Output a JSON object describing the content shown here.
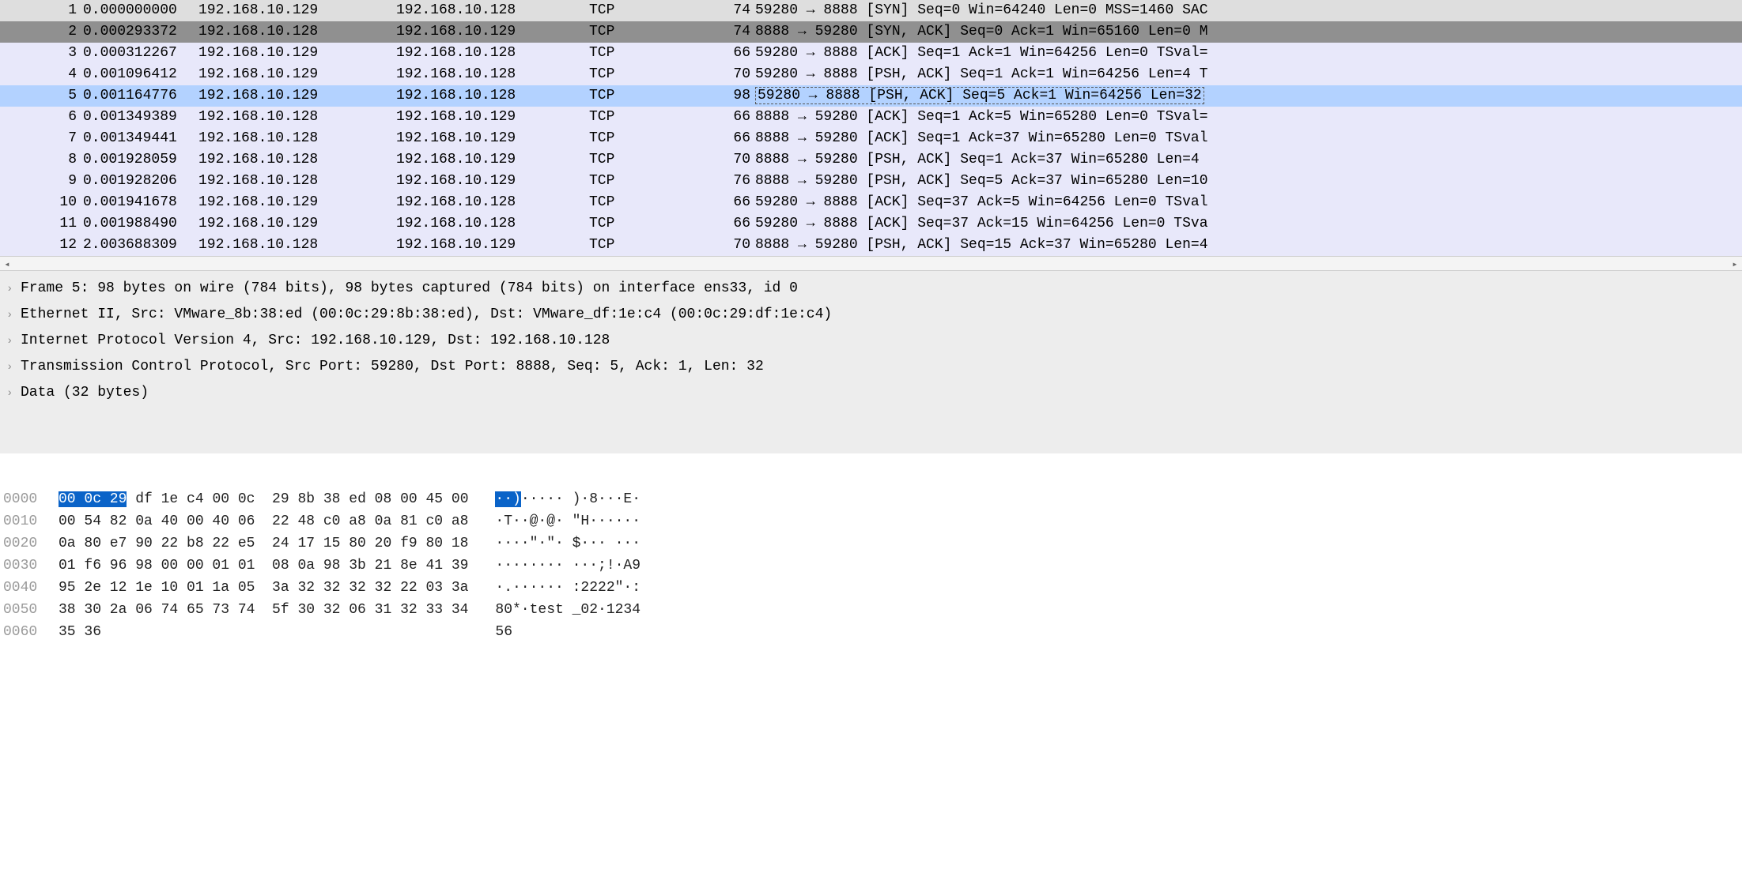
{
  "packets": [
    {
      "no": "1",
      "time": "0.000000000",
      "src": "192.168.10.129",
      "dst": "192.168.10.128",
      "prot": "TCP",
      "len": "74",
      "info": "59280 → 8888 [SYN] Seq=0 Win=64240 Len=0 MSS=1460 SAC",
      "cls": "row-syn"
    },
    {
      "no": "2",
      "time": "0.000293372",
      "src": "192.168.10.128",
      "dst": "192.168.10.129",
      "prot": "TCP",
      "len": "74",
      "info": "8888 → 59280 [SYN, ACK] Seq=0 Ack=1 Win=65160 Len=0 M",
      "cls": "row-synack"
    },
    {
      "no": "3",
      "time": "0.000312267",
      "src": "192.168.10.129",
      "dst": "192.168.10.128",
      "prot": "TCP",
      "len": "66",
      "info": "59280 → 8888 [ACK] Seq=1 Ack=1 Win=64256 Len=0 TSval=",
      "cls": "row-tcp"
    },
    {
      "no": "4",
      "time": "0.001096412",
      "src": "192.168.10.129",
      "dst": "192.168.10.128",
      "prot": "TCP",
      "len": "70",
      "info": "59280 → 8888 [PSH, ACK] Seq=1 Ack=1 Win=64256 Len=4 T",
      "cls": "row-tcp"
    },
    {
      "no": "5",
      "time": "0.001164776",
      "src": "192.168.10.129",
      "dst": "192.168.10.128",
      "prot": "TCP",
      "len": "98",
      "info": "59280 → 8888 [PSH, ACK] Seq=5 Ack=1 Win=64256 Len=32 ",
      "cls": "row-selected"
    },
    {
      "no": "6",
      "time": "0.001349389",
      "src": "192.168.10.128",
      "dst": "192.168.10.129",
      "prot": "TCP",
      "len": "66",
      "info": "8888 → 59280 [ACK] Seq=1 Ack=5 Win=65280 Len=0 TSval=",
      "cls": "row-tcp"
    },
    {
      "no": "7",
      "time": "0.001349441",
      "src": "192.168.10.128",
      "dst": "192.168.10.129",
      "prot": "TCP",
      "len": "66",
      "info": "8888 → 59280 [ACK] Seq=1 Ack=37 Win=65280 Len=0 TSval",
      "cls": "row-tcp"
    },
    {
      "no": "8",
      "time": "0.001928059",
      "src": "192.168.10.128",
      "dst": "192.168.10.129",
      "prot": "TCP",
      "len": "70",
      "info": "8888 → 59280 [PSH, ACK] Seq=1 Ack=37 Win=65280 Len=4 ",
      "cls": "row-tcp"
    },
    {
      "no": "9",
      "time": "0.001928206",
      "src": "192.168.10.128",
      "dst": "192.168.10.129",
      "prot": "TCP",
      "len": "76",
      "info": "8888 → 59280 [PSH, ACK] Seq=5 Ack=37 Win=65280 Len=10",
      "cls": "row-tcp"
    },
    {
      "no": "10",
      "time": "0.001941678",
      "src": "192.168.10.129",
      "dst": "192.168.10.128",
      "prot": "TCP",
      "len": "66",
      "info": "59280 → 8888 [ACK] Seq=37 Ack=5 Win=64256 Len=0 TSval",
      "cls": "row-tcp"
    },
    {
      "no": "11",
      "time": "0.001988490",
      "src": "192.168.10.129",
      "dst": "192.168.10.128",
      "prot": "TCP",
      "len": "66",
      "info": "59280 → 8888 [ACK] Seq=37 Ack=15 Win=64256 Len=0 TSva",
      "cls": "row-tcp"
    },
    {
      "no": "12",
      "time": "2.003688309",
      "src": "192.168.10.128",
      "dst": "192.168.10.129",
      "prot": "TCP",
      "len": "70",
      "info": "8888 → 59280 [PSH, ACK] Seq=15 Ack=37 Win=65280 Len=4",
      "cls": "row-tcp"
    }
  ],
  "details": [
    "Frame 5: 98 bytes on wire (784 bits), 98 bytes captured (784 bits) on interface ens33, id 0",
    "Ethernet II, Src: VMware_8b:38:ed (00:0c:29:8b:38:ed), Dst: VMware_df:1e:c4 (00:0c:29:df:1e:c4)",
    "Internet Protocol Version 4, Src: 192.168.10.129, Dst: 192.168.10.128",
    "Transmission Control Protocol, Src Port: 59280, Dst Port: 8888, Seq: 5, Ack: 1, Len: 32",
    "Data (32 bytes)"
  ],
  "hex": [
    {
      "off": "0000",
      "hl": "00 0c 29",
      "b1": " df 1e c4 00 0c",
      "b2": "29 8b 38 ed 08 00 45 00",
      "aschl": "··)",
      "asc": "····· )·8···E·"
    },
    {
      "off": "0010",
      "hl": "",
      "b1": "00 54 82 0a 40 00 40 06",
      "b2": "22 48 c0 a8 0a 81 c0 a8",
      "aschl": "",
      "asc": "·T··@·@· \"H······"
    },
    {
      "off": "0020",
      "hl": "",
      "b1": "0a 80 e7 90 22 b8 22 e5",
      "b2": "24 17 15 80 20 f9 80 18",
      "aschl": "",
      "asc": "····\"·\"· $··· ···"
    },
    {
      "off": "0030",
      "hl": "",
      "b1": "01 f6 96 98 00 00 01 01",
      "b2": "08 0a 98 3b 21 8e 41 39",
      "aschl": "",
      "asc": "········ ···;!·A9"
    },
    {
      "off": "0040",
      "hl": "",
      "b1": "95 2e 12 1e 10 01 1a 05",
      "b2": "3a 32 32 32 32 22 03 3a",
      "aschl": "",
      "asc": "·.······ :2222\"·:"
    },
    {
      "off": "0050",
      "hl": "",
      "b1": "38 30 2a 06 74 65 73 74",
      "b2": "5f 30 32 06 31 32 33 34",
      "aschl": "",
      "asc": "80*·test _02·1234"
    },
    {
      "off": "0060",
      "hl": "",
      "b1": "35 36",
      "b2": "",
      "aschl": "",
      "asc": "56"
    }
  ]
}
